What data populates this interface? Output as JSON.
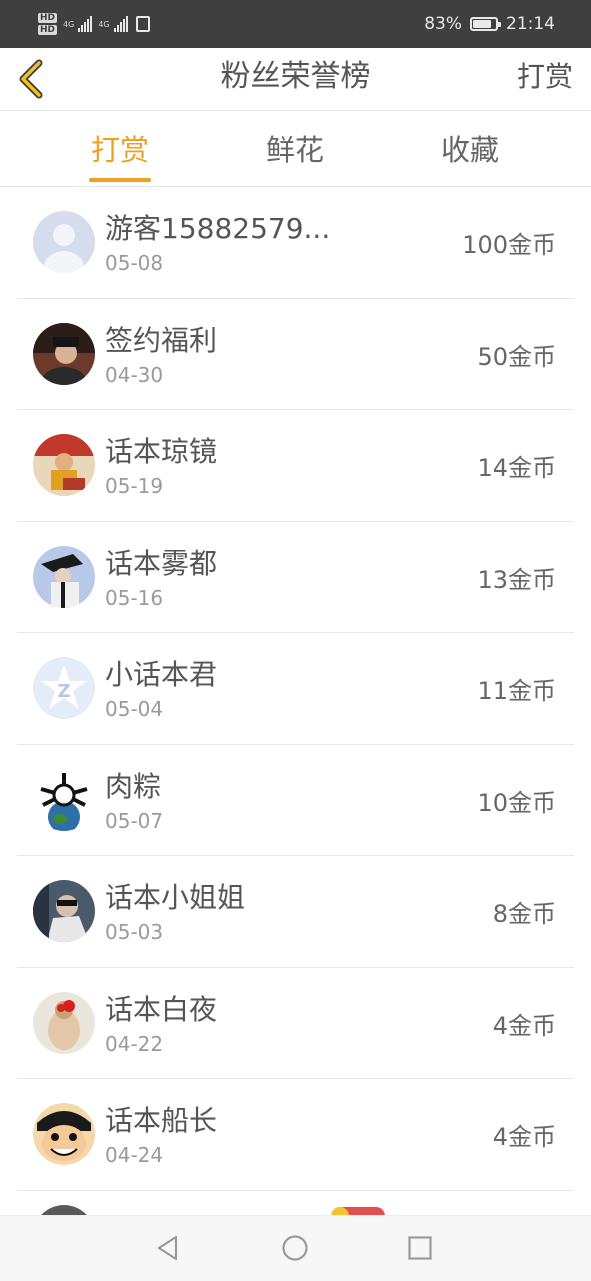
{
  "status_bar": {
    "hd1": "HD",
    "hd2": "HD",
    "net1": "4G",
    "net2": "4G",
    "battery_percent": "83%",
    "time": "21:14",
    "battery_level": 0.83
  },
  "navbar": {
    "title": "粉丝荣誉榜",
    "action": "打赏",
    "back_icon": "chevron-left-icon",
    "accent": "#f0c020"
  },
  "tabs": [
    {
      "label": "打赏",
      "active": true
    },
    {
      "label": "鲜花",
      "active": false
    },
    {
      "label": "收藏",
      "active": false
    }
  ],
  "colors": {
    "accent": "#f0a020",
    "partial_name": "#e05a30"
  },
  "list": [
    {
      "name": "游客15882579...",
      "date": "05-08",
      "amount": "100金币"
    },
    {
      "name": "签约福利",
      "date": "04-30",
      "amount": "50金币"
    },
    {
      "name": "话本琼镜",
      "date": "05-19",
      "amount": "14金币"
    },
    {
      "name": "话本雾都",
      "date": "05-16",
      "amount": "13金币"
    },
    {
      "name": "小话本君",
      "date": "05-04",
      "amount": "11金币"
    },
    {
      "name": "肉粽",
      "date": "05-07",
      "amount": "10金币"
    },
    {
      "name": "话本小姐姐",
      "date": "05-03",
      "amount": "8金币"
    },
    {
      "name": "话本白夜",
      "date": "04-22",
      "amount": "4金币"
    },
    {
      "name": "话本船长",
      "date": "04-24",
      "amount": "4金币"
    }
  ],
  "system_nav": {
    "back": "triangle-back-icon",
    "home": "circle-home-icon",
    "recents": "square-recents-icon"
  }
}
